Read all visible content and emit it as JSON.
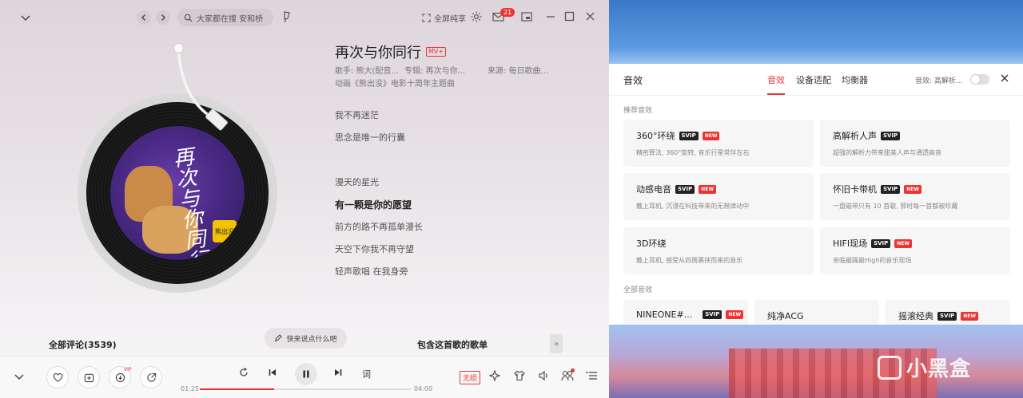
{
  "header": {
    "search_placeholder": "大家都在搜 安和桥",
    "fullscreen_label": "全屏纯享",
    "mail_count": "21"
  },
  "song": {
    "title": "再次与你同行",
    "mv_badge": "MV+",
    "singer": "歌手: 熊大(配音...",
    "album": "专辑: 再次与你...",
    "source": "来源: 每日歌曲...",
    "description": "动画《熊出没》电影十周年主题曲",
    "cover_title": "再次与你同行",
    "cover_logo": "熊出没"
  },
  "lyrics": [
    {
      "text": "我不再迷茫",
      "active": false
    },
    {
      "text": "思念是唯一的行囊",
      "active": false
    },
    {
      "text": "漫天的星光",
      "active": false
    },
    {
      "text": "有一颗是你的愿望",
      "active": true
    },
    {
      "text": "前方的路不再孤单漫长",
      "active": false
    },
    {
      "text": "天空下你我不再守望",
      "active": false
    },
    {
      "text": "轻声歌唱 在我身旁",
      "active": false
    }
  ],
  "comments": {
    "title": "全部评论(3539)",
    "compose_label": "快来说点什么吧",
    "playlist_title": "包含这首歌的歌单",
    "expand_label": "»"
  },
  "playback": {
    "current_time": "01:25",
    "total_time": "04:00",
    "progress": 0.354,
    "lyrics_label": "词",
    "quality_label": "无损",
    "vip_label": "VIP"
  },
  "fx_panel": {
    "title": "音效",
    "tabs": [
      {
        "label": "音效",
        "active": true
      },
      {
        "label": "设备适配",
        "active": false
      },
      {
        "label": "均衡器",
        "active": false
      }
    ],
    "status": "音效: 高解析...",
    "recommended_label": "推荐音效",
    "all_label": "全部音效",
    "svip_label": "SVIP",
    "new_label": "NEW",
    "recommended": [
      {
        "name": "360°环绕",
        "desc": "精密算法, 360°旋转, 音乐行星常伴左右"
      },
      {
        "name": "高解析人声",
        "desc": "超强的解析力带来甜美人声与通透高音"
      },
      {
        "name": "动感电音",
        "desc": "戴上耳机, 沉浸在科技带来的无限律动中"
      },
      {
        "name": "怀旧卡带机",
        "desc": "一盘磁带只有 10 首歌, 那时每一首都被珍藏"
      },
      {
        "name": "3D环绕",
        "desc": "戴上耳机, 感受从四周裹挟而来的音乐"
      },
      {
        "name": "HIFI现场",
        "desc": "亲临最躁最High的音乐现场"
      }
    ],
    "all": [
      {
        "name": "NINEONE#..."
      },
      {
        "name": "纯净ACG"
      },
      {
        "name": "摇滚经典"
      }
    ]
  },
  "watermark": "小黑盒",
  "colors": {
    "accent": "#e33333",
    "panel": "#ffffff"
  }
}
